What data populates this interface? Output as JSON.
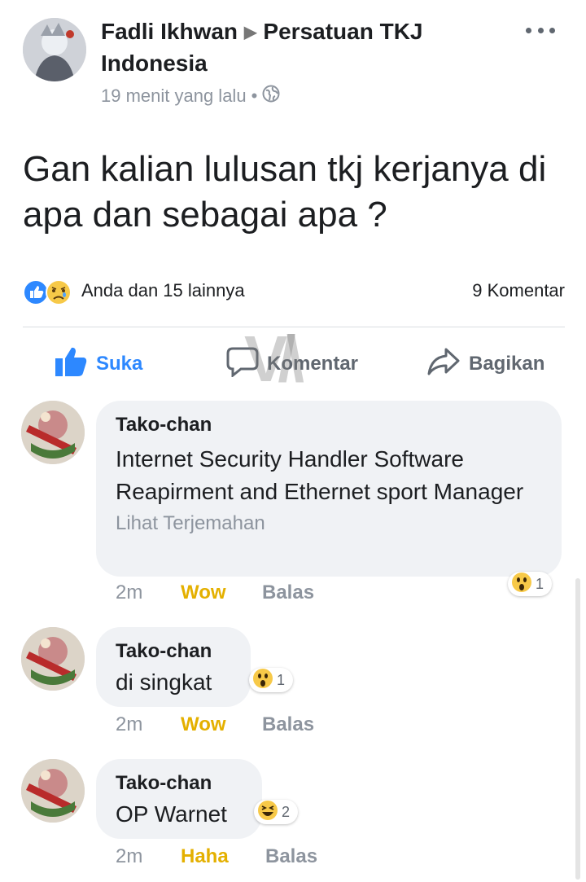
{
  "post": {
    "author": "Fadli Ikhwan",
    "group": "Persatuan TKJ Indonesia",
    "time": "19 menit yang lalu",
    "separator": "•",
    "privacy_icon": "globe-icon",
    "text": "Gan kalian lulusan tkj kerjanya di apa dan sebagai  apa ?",
    "reactions_summary": "Anda dan 15 lainnya",
    "comment_count": "9 Komentar",
    "reaction_icons": [
      "like-icon",
      "sad-icon"
    ]
  },
  "actions": {
    "like": "Suka",
    "comment": "Komentar",
    "share": "Bagikan"
  },
  "comments": [
    {
      "name": "Tako-chan",
      "text": "Internet Security Handler Software Reapirment and Ethernet sport Manager",
      "translate": "Lihat Terjemahan",
      "time": "2m",
      "reaction_label": "Wow",
      "reply": "Balas",
      "badge_icon": "wow-icon",
      "badge_count": "1"
    },
    {
      "name": "Tako-chan",
      "text": "di singkat",
      "time": "2m",
      "reaction_label": "Wow",
      "reply": "Balas",
      "badge_icon": "wow-icon",
      "badge_count": "1"
    },
    {
      "name": "Tako-chan",
      "text": "OP Warnet",
      "time": "2m",
      "reaction_label": "Haha",
      "reply": "Balas",
      "badge_icon": "haha-icon",
      "badge_count": "2"
    }
  ],
  "colors": {
    "like_blue": "#2d88ff",
    "reaction_yellow": "#e4b000",
    "bubble_bg": "#f0f2f5",
    "muted_text": "#8d949e"
  }
}
